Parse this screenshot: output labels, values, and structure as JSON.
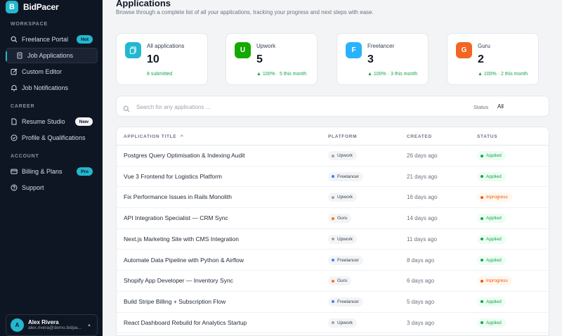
{
  "brand": {
    "logo_letter": "B",
    "name": "BidPacer"
  },
  "sidebar": {
    "sections": [
      {
        "title": "WORKSPACE"
      },
      {
        "title": "CAREER"
      },
      {
        "title": "ACCOUNT"
      }
    ],
    "items": [
      {
        "label": "Freelance Portal",
        "icon": "search-icon",
        "badge": "Hot"
      },
      {
        "label": "Job Applications",
        "icon": "document-icon",
        "active": true
      },
      {
        "label": "Custom Editor",
        "icon": "edit-icon"
      },
      {
        "label": "Job Notifications",
        "icon": "bell-icon"
      },
      {
        "label": "Resume Studio",
        "icon": "file-icon",
        "badge": "New"
      },
      {
        "label": "Profile & Qualifications",
        "icon": "user-check-icon"
      },
      {
        "label": "Billing & Plans",
        "icon": "credit-card-icon",
        "badge": "Pro"
      },
      {
        "label": "Support",
        "icon": "help-circle-icon"
      }
    ],
    "user": {
      "initial": "A",
      "name": "Alex Rivera",
      "email": "alex.rivera@demo.bidpa..."
    }
  },
  "header": {
    "title": "Applications",
    "subtitle": "Browse through a complete list of all your applications, tracking your progress and next steps with ease."
  },
  "cards": [
    {
      "label": "All applications",
      "value": "10",
      "footer": "8 submitted",
      "icon_letter": "",
      "color": "#22b8cf"
    },
    {
      "label": "Upwork",
      "value": "5",
      "footer": "▲ 100% · 5 this month",
      "icon_letter": "U",
      "color": "#14a800"
    },
    {
      "label": "Freelancer",
      "value": "3",
      "footer": "▲ 100% · 3 this month",
      "icon_letter": "F",
      "color": "#29b2fe"
    },
    {
      "label": "Guru",
      "value": "2",
      "footer": "▲ 100% · 2 this month",
      "icon_letter": "G",
      "color": "#f26522"
    }
  ],
  "search": {
    "placeholder": "Search for any applications ...",
    "status_label": "Status",
    "status_value": "All"
  },
  "table": {
    "columns": [
      "APPLICATION TITLE",
      "PLATFORM",
      "CREATED",
      "STATUS"
    ],
    "sort_indicator": "^",
    "rows": [
      {
        "title": "Postgres Query Optimisation & Indexing Audit",
        "platform": "Upwork",
        "created": "26 days ago",
        "status": "Applied"
      },
      {
        "title": "Vue 3 Frontend for Logistics Platform",
        "platform": "Freelancer",
        "created": "21 days ago",
        "status": "Applied"
      },
      {
        "title": "Fix Performance Issues in Rails Monolith",
        "platform": "Upwork",
        "created": "16 days ago",
        "status": "Inprogress"
      },
      {
        "title": "API Integration Specialist — CRM Sync",
        "platform": "Guru",
        "created": "14 days ago",
        "status": "Applied"
      },
      {
        "title": "Next.js Marketing Site with CMS Integration",
        "platform": "Upwork",
        "created": "11 days ago",
        "status": "Applied"
      },
      {
        "title": "Automate Data Pipeline with Python & Airflow",
        "platform": "Freelancer",
        "created": "8 days ago",
        "status": "Applied"
      },
      {
        "title": "Shopify App Developer — Inventory Sync",
        "platform": "Guru",
        "created": "6 days ago",
        "status": "Inprogress"
      },
      {
        "title": "Build Stripe Billing + Subscription Flow",
        "platform": "Freelancer",
        "created": "5 days ago",
        "status": "Applied"
      },
      {
        "title": "React Dashboard Rebuild for Analytics Startup",
        "platform": "Upwork",
        "created": "3 days ago",
        "status": "Applied"
      }
    ]
  },
  "colors": {
    "accent": "#22b8cf",
    "sidebar_bg": "#0f1623",
    "applied": "#16a34a",
    "inprogress": "#ea580c",
    "platform_dots": {
      "Upwork": "#9ca3af",
      "Freelancer": "#3b82f6",
      "Guru": "#f97316"
    }
  }
}
